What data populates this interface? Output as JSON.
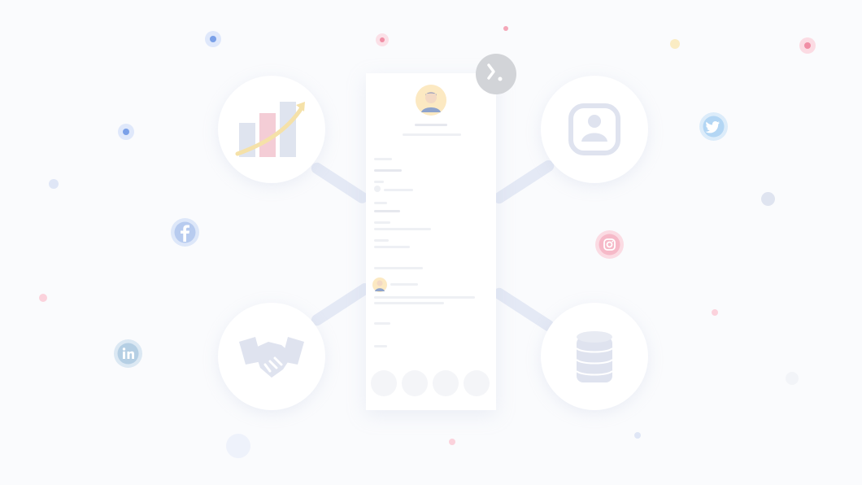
{
  "app": {
    "terminal_badge_icon": "terminal-icon"
  },
  "hubs": [
    {
      "id": "analytics",
      "icon": "bar-chart-growth-icon"
    },
    {
      "id": "profile",
      "icon": "user-profile-icon"
    },
    {
      "id": "partnership",
      "icon": "handshake-icon"
    },
    {
      "id": "database",
      "icon": "database-icon"
    }
  ],
  "social_icons": [
    {
      "id": "facebook",
      "icon": "facebook-icon",
      "color": "#4a7bd8"
    },
    {
      "id": "twitter",
      "icon": "twitter-icon",
      "color": "#4aa3e8"
    },
    {
      "id": "instagram",
      "icon": "instagram-icon",
      "color": "#e8597a"
    },
    {
      "id": "linkedin",
      "icon": "linkedin-icon",
      "color": "#3a7fb0"
    }
  ],
  "profile_card": {
    "avatar_icon": "user-avatar-icon",
    "action_buttons": [
      "action-button-1",
      "action-button-2",
      "action-button-3",
      "action-button-4"
    ]
  },
  "colors": {
    "background": "#fafbfd",
    "accent_blue": "#4a6ab5",
    "accent_pink": "#e8597a",
    "accent_yellow": "#f2c443",
    "connector": "#e4e9f5"
  }
}
